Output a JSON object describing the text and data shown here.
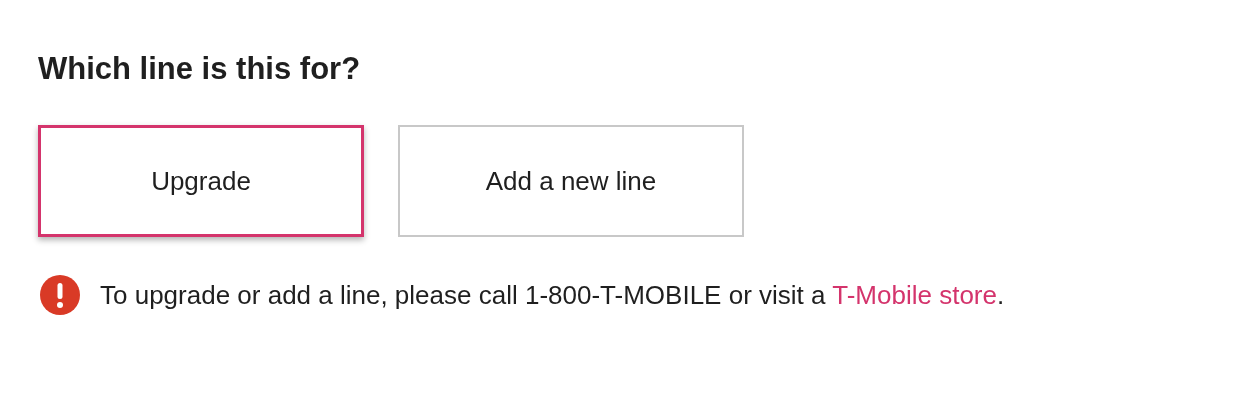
{
  "heading": "Which line is this for?",
  "options": [
    {
      "label": "Upgrade",
      "selected": true
    },
    {
      "label": "Add a new line",
      "selected": false
    }
  ],
  "notice": {
    "kind": "error",
    "text": "To upgrade or add a line, please call 1-800-T-MOBILE or visit a ",
    "link": "T-Mobile store",
    "after": "."
  }
}
